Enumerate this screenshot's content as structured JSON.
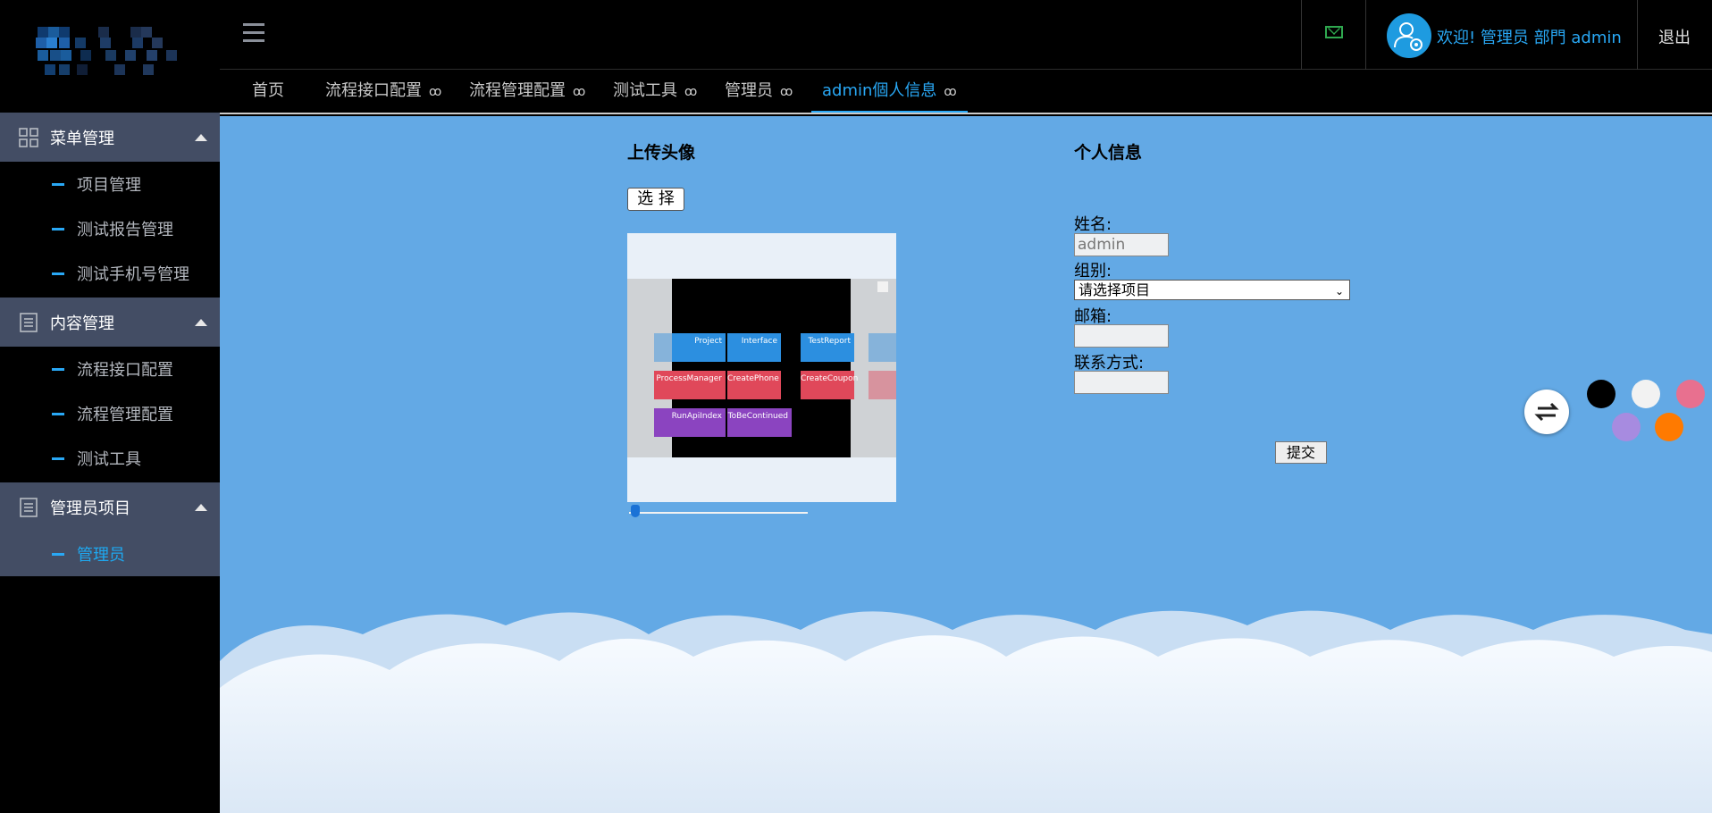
{
  "sidebar": {
    "groups": [
      {
        "label": "菜单管理",
        "items": [
          "项目管理",
          "测试报告管理",
          "测试手机号管理"
        ]
      },
      {
        "label": "内容管理",
        "items": [
          "流程接口配置",
          "流程管理配置",
          "测试工具"
        ]
      },
      {
        "label": "管理员项目",
        "items": [
          "管理员"
        ]
      }
    ]
  },
  "header": {
    "welcome": "欢迎! 管理员 部門 admin",
    "logout": "退出"
  },
  "tabs": [
    {
      "label": "首页"
    },
    {
      "label": "流程接口配置",
      "close": "ꝏ"
    },
    {
      "label": "流程管理配置",
      "close": "ꝏ"
    },
    {
      "label": "测试工具",
      "close": "ꝏ"
    },
    {
      "label": "管理员",
      "close": "ꝏ"
    },
    {
      "label": "admin個人信息",
      "close": "ꝏ"
    }
  ],
  "upload": {
    "title": "上传头像",
    "choose_button": "选 择",
    "preview_tiles": [
      "Project",
      "Interface",
      "TestReport",
      "ProcessManager",
      "CreatePhone",
      "CreateCoupon",
      "RunApiIndex",
      "ToBeContinued"
    ]
  },
  "profile": {
    "title": "个人信息",
    "name_label": "姓名:",
    "name_value": "admin",
    "group_label": "组别:",
    "group_selected": "请选择项目",
    "email_label": "邮箱:",
    "email_value": "",
    "contact_label": "联系方式:",
    "contact_value": "",
    "submit": "提交"
  },
  "theme_colors": [
    "#000000",
    "#f2f2f2",
    "#e8708f",
    "#a78be0",
    "#ff7a00"
  ],
  "colors": {
    "accent": "#29a8f5",
    "content_bg": "#63a9e5",
    "menu_group_bg": "#434d64"
  }
}
